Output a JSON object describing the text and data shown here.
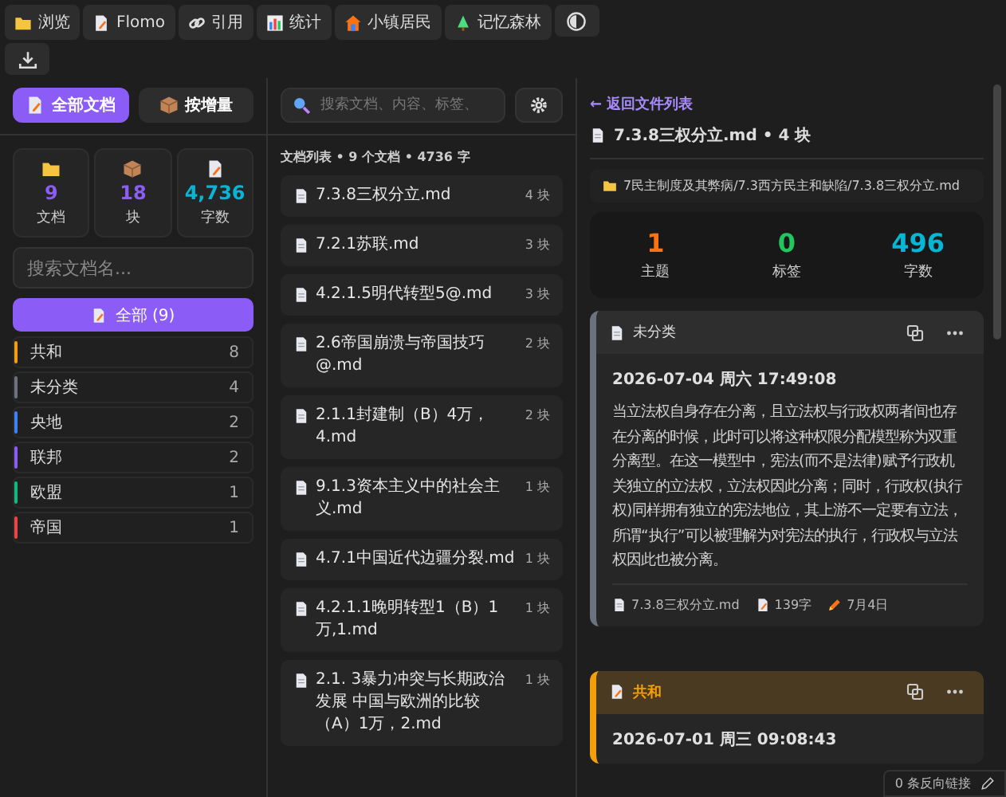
{
  "toolbar": {
    "tabs": [
      {
        "label": "浏览"
      },
      {
        "label": "Flomo"
      },
      {
        "label": "引用"
      },
      {
        "label": "统计"
      },
      {
        "label": "小镇居民"
      },
      {
        "label": "记忆森林"
      }
    ]
  },
  "left": {
    "modes": [
      {
        "label": "全部文档",
        "selected": true
      },
      {
        "label": "按增量",
        "selected": false
      }
    ],
    "stats": [
      {
        "value": "9",
        "label": "文档",
        "color": "#8b5cf6"
      },
      {
        "value": "18",
        "label": "块",
        "color": "#8b5cf6"
      },
      {
        "value": "4,736",
        "label": "字数",
        "color": "#06b6d4"
      }
    ],
    "search": {
      "placeholder": "搜索文档名..."
    },
    "all_button": "全部 (9)",
    "categories": [
      {
        "name": "共和",
        "count": "8",
        "color": "#f59e0b"
      },
      {
        "name": "未分类",
        "count": "4",
        "color": "#6b7280"
      },
      {
        "name": "央地",
        "count": "2",
        "color": "#3b82f6"
      },
      {
        "name": "联邦",
        "count": "2",
        "color": "#8b5cf6"
      },
      {
        "name": "欧盟",
        "count": "1",
        "color": "#10b981"
      },
      {
        "name": "帝国",
        "count": "1",
        "color": "#ef4444"
      }
    ]
  },
  "middle": {
    "search": {
      "placeholder": "搜索文档、内容、标签、"
    },
    "heading": "文档列表 • 9 个文档 • 4736 字",
    "docs": [
      {
        "name": "7.3.8三权分立.md",
        "blocks": "4 块"
      },
      {
        "name": "7.2.1苏联.md",
        "blocks": "3 块"
      },
      {
        "name": "4.2.1.5明代转型5@.md",
        "blocks": "3 块"
      },
      {
        "name": "2.6帝国崩溃与帝国技巧@.md",
        "blocks": "2 块"
      },
      {
        "name": "2.1.1封建制（B）4万，4.md",
        "blocks": "2 块"
      },
      {
        "name": "9.1.3资本主义中的社会主义.md",
        "blocks": "1 块"
      },
      {
        "name": "4.7.1中国近代边疆分裂.md",
        "blocks": "1 块"
      },
      {
        "name": "4.2.1.1晚明转型1（B）1万,1.md",
        "blocks": "1 块"
      },
      {
        "name": "2.1. 3暴力冲突与长期政治发展 中国与欧洲的比较（A）1万，2.md",
        "blocks": "1 块"
      }
    ]
  },
  "right": {
    "back": "← 返回文件列表",
    "title": "7.3.8三权分立.md • 4 块",
    "path": "7民主制度及其弊病/7.3西方民主和缺陷/7.3.8三权分立.md",
    "stats": [
      {
        "value": "1",
        "label": "主题",
        "color": "#f97316"
      },
      {
        "value": "0",
        "label": "标签",
        "color": "#22c55e"
      },
      {
        "value": "496",
        "label": "字数",
        "color": "#06b6d4"
      }
    ],
    "cards": [
      {
        "category": "未分类",
        "color": "#6b7280",
        "tinted": false,
        "date": "2026-07-04 周六 17:49:08",
        "body": "当立法权自身存在分离，且立法权与行政权两者间也存在分离的时候，此时可以将这种权限分配模型称为双重分离型。在这一模型中，宪法(而不是法律)赋予行政机关独立的立法权，立法权因此分离；同时，行政权(执行权)同样拥有独立的宪法地位，其上游不一定要有立法，所谓“执行”可以被理解为对宪法的执行，行政权与立法权因此也被分离。",
        "meta": {
          "file": "7.3.8三权分立.md",
          "chars": "139字",
          "date": "7月4日"
        }
      },
      {
        "category": "共和",
        "color": "#f59e0b",
        "tinted": true,
        "date": "2026-07-01 周三 09:08:43"
      }
    ]
  },
  "status": {
    "backlinks": "0 条反向链接"
  }
}
